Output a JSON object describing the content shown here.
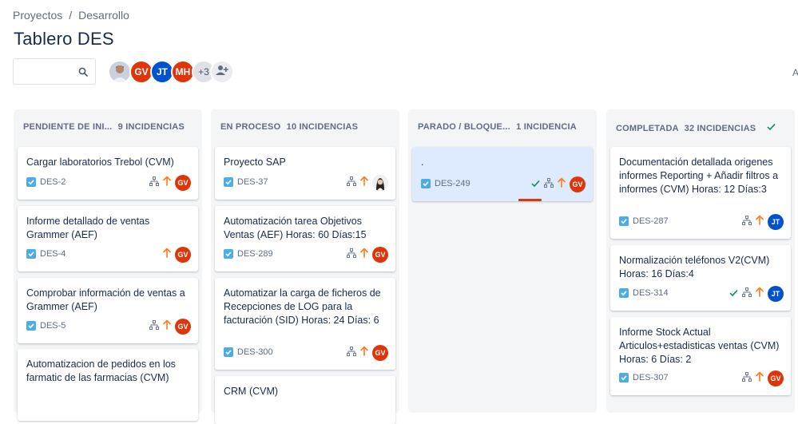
{
  "breadcrumb": {
    "items": [
      "Proyectos",
      "Desarrollo"
    ],
    "separator": "/"
  },
  "page_title": "Tablero DES",
  "search": {
    "value": "",
    "placeholder": ""
  },
  "people": {
    "avatars": [
      "GV",
      "JT",
      "MH"
    ],
    "more": "+3"
  },
  "right_cut_text": "A",
  "colors": {
    "orange_priority": "#ff7a1a",
    "gv": "#de350b",
    "jt": "#0052cc",
    "done": "#00875a",
    "checkbox": "#4bade8"
  },
  "columns": [
    {
      "title": "PENDIENTE DE INI...",
      "count": "9 INCIDENCIAS",
      "cards": [
        {
          "title": "Cargar laboratorios Trebol (CVM)",
          "key": "DES-2",
          "subtasks": true,
          "priority": true,
          "assignee": "GV"
        },
        {
          "title": "Informe detallado de ventas Grammer (AEF)",
          "key": "DES-4",
          "subtasks": false,
          "priority": true,
          "assignee": "GV"
        },
        {
          "title": "Comprobar información de ventas a Grammer (AEF)",
          "key": "DES-5",
          "subtasks": true,
          "priority": true,
          "assignee": "GV"
        },
        {
          "title": "Automatizacion de pedidos en los farmatic de las farmacias (CVM)",
          "key": "",
          "subtasks": false,
          "priority": false,
          "assignee": ""
        }
      ]
    },
    {
      "title": "EN PROCESO",
      "count": "10 INCIDENCIAS",
      "cards": [
        {
          "title": "Proyecto SAP",
          "key": "DES-37",
          "subtasks": true,
          "priority": true,
          "assignee": "photo"
        },
        {
          "title": "Automatización tarea Objetivos Ventas (AEF) Horas: 60 Días:15",
          "key": "DES-289",
          "subtasks": true,
          "priority": true,
          "assignee": "GV"
        },
        {
          "title": "Automatizar la carga de ficheros de Recepciones de LOG para la facturación (SID) Horas: 24 Días: 6",
          "key": "DES-300",
          "subtasks": true,
          "priority": true,
          "assignee": "GV"
        },
        {
          "title": "CRM (CVM)",
          "key": "",
          "subtasks": false,
          "priority": false,
          "assignee": ""
        }
      ]
    },
    {
      "title": "PARADO / BLOQUE...",
      "count": "1 INCIDENCIA",
      "cards": [
        {
          "title": ".",
          "key": "DES-249",
          "subtasks": true,
          "priority": true,
          "assignee": "GV",
          "done": true
        }
      ]
    },
    {
      "title": "COMPLETADA",
      "count": "32 INCIDENCIAS",
      "cards": [
        {
          "title": "Documentación detallada origenes informes Reporting + Añadir filtros a informes (CVM) Horas: 12 Días:3",
          "key": "DES-287",
          "subtasks": true,
          "priority": true,
          "assignee": "JT"
        },
        {
          "title": "Normalización teléfonos V2(CVM) Horas: 16 Días:4",
          "key": "DES-314",
          "subtasks": true,
          "priority": true,
          "assignee": "JT",
          "done": true
        },
        {
          "title": "Informe Stock Actual Articulos+estadisticas ventas (CVM) Horas: 6 Días: 2",
          "key": "DES-307",
          "subtasks": true,
          "priority": true,
          "assignee": "GV"
        }
      ]
    }
  ]
}
